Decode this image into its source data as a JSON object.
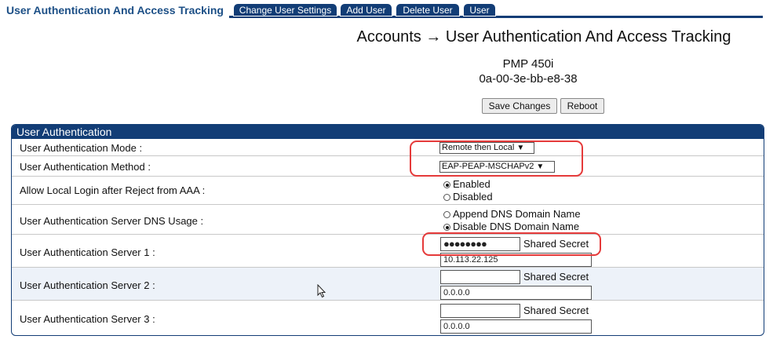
{
  "page": {
    "section_title": "User Authentication And Access Tracking",
    "tabs": [
      {
        "label": "Change User Settings"
      },
      {
        "label": "Add User"
      },
      {
        "label": "Delete User"
      },
      {
        "label": "User"
      }
    ],
    "title": "Accounts → User Authentication And Access Tracking",
    "device_name": "PMP 450i",
    "device_mac": "0a-00-3e-bb-e8-38",
    "save_label": "Save Changes",
    "reboot_label": "Reboot"
  },
  "panel": {
    "header": "User Authentication",
    "mode": {
      "label": "User Authentication Mode :",
      "value": "Remote then Local"
    },
    "method": {
      "label": "User Authentication Method :",
      "value": "EAP-PEAP-MSCHAPv2"
    },
    "local_login": {
      "label": "Allow Local Login after Reject from AAA :",
      "options": [
        "Enabled",
        "Disabled"
      ],
      "selected": "Enabled"
    },
    "dns_usage": {
      "label": "User Authentication Server DNS Usage :",
      "options": [
        "Append DNS Domain Name",
        "Disable DNS Domain Name"
      ],
      "selected": "Disable DNS Domain Name"
    },
    "servers": [
      {
        "label": "User Authentication Server 1 :",
        "secret_value": "●●●●●●●●",
        "secret_label": "Shared Secret",
        "address": "10.113.22.125"
      },
      {
        "label": "User Authentication Server 2 :",
        "secret_value": "",
        "secret_label": "Shared Secret",
        "address": "0.0.0.0"
      },
      {
        "label": "User Authentication Server 3 :",
        "secret_value": "",
        "secret_label": "Shared Secret",
        "address": "0.0.0.0"
      }
    ]
  },
  "colors": {
    "accent": "#123d76",
    "highlight": "#e53a3a",
    "title_text": "#1c4f86"
  },
  "icons": {
    "dropdown": "chevron-down-icon",
    "pointer": "mouse-pointer-icon"
  }
}
